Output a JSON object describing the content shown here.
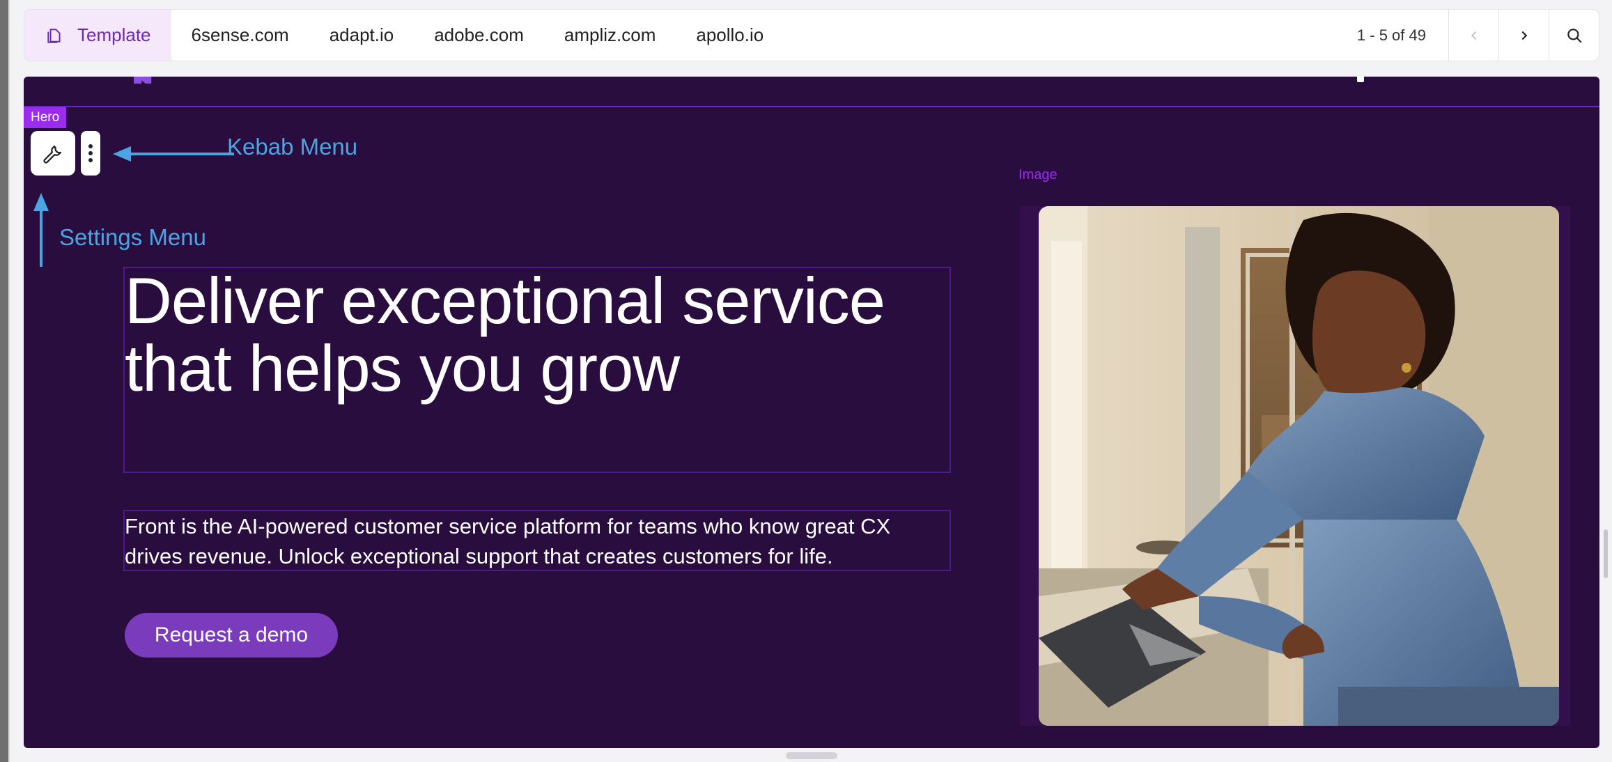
{
  "toolbar": {
    "tabs": [
      {
        "label": "Template",
        "active": true
      },
      {
        "label": "6sense.com"
      },
      {
        "label": "adapt.io"
      },
      {
        "label": "adobe.com"
      },
      {
        "label": "ampliz.com"
      },
      {
        "label": "apollo.io"
      }
    ],
    "pager": "1 - 5 of 49",
    "icons": [
      "template-icon",
      "chevron-left-icon",
      "chevron-right-icon",
      "search-icon"
    ]
  },
  "editor": {
    "section_tag": "Hero",
    "image_label": "Image",
    "annotations": {
      "kebab": "Kebab Menu",
      "settings": "Settings Menu"
    },
    "icons": [
      "wrench-icon",
      "kebab-icon"
    ]
  },
  "hero": {
    "headline": "Deliver exceptional service that helps you grow",
    "subtext": "Front is the AI-powered customer service platform for teams who know great CX drives revenue. Unlock exceptional support that creates customers for life.",
    "cta": "Request a demo"
  },
  "colors": {
    "page_bg": "#2a0d3f",
    "accent": "#9b2bef",
    "button": "#7b3bbd",
    "annotation": "#4aa6e2",
    "tab_active_bg": "#f6e8fb"
  }
}
